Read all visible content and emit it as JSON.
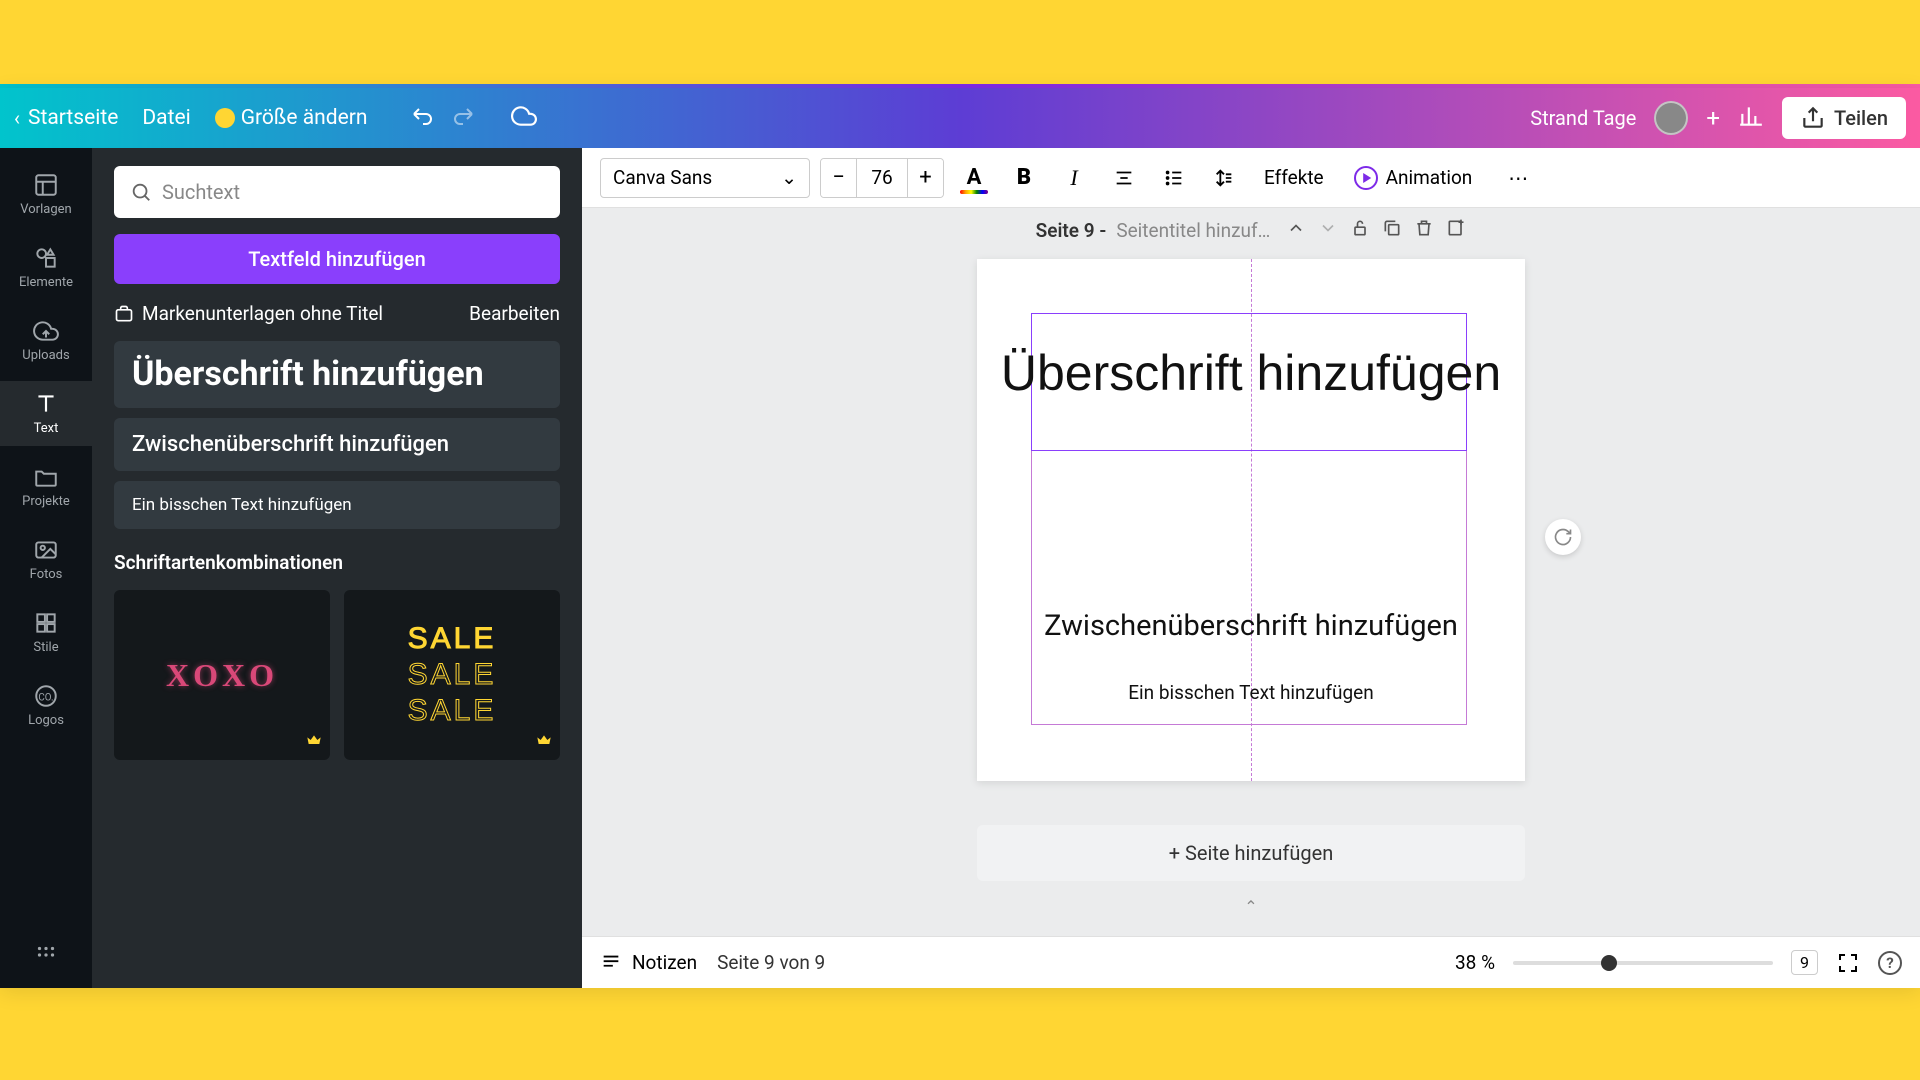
{
  "header": {
    "home": "Startseite",
    "file": "Datei",
    "resize": "Größe ändern",
    "design_name": "Strand Tage",
    "share": "Teilen"
  },
  "rail": {
    "templates": "Vorlagen",
    "elements": "Elemente",
    "uploads": "Uploads",
    "text": "Text",
    "projects": "Projekte",
    "photos": "Fotos",
    "styles": "Stile",
    "logos": "Logos"
  },
  "panel": {
    "search_placeholder": "Suchtext",
    "add_textbox": "Textfeld hinzufügen",
    "brand_kit": "Markenunterlagen ohne Titel",
    "edit": "Bearbeiten",
    "preset_heading": "Überschrift hinzufügen",
    "preset_subheading": "Zwischenüberschrift hinzufügen",
    "preset_body": "Ein bisschen Text hinzufügen",
    "font_combos_title": "Schriftartenkombinationen",
    "combo1": "XOXO",
    "combo2": "SALE"
  },
  "toolbar": {
    "font": "Canva Sans",
    "size": "76",
    "effects": "Effekte",
    "animation": "Animation"
  },
  "page_bar": {
    "label": "Seite 9 -",
    "title_placeholder": "Seitentitel hinzuf…"
  },
  "canvas": {
    "heading": "Überschrift hinzufügen",
    "subheading": "Zwischenüberschrift hinzufügen",
    "body": "Ein bisschen Text hinzufügen",
    "add_page": "+ Seite hinzufügen"
  },
  "footer": {
    "notes": "Notizen",
    "page_counter": "Seite 9 von 9",
    "zoom": "38 %",
    "page_num": "9"
  }
}
